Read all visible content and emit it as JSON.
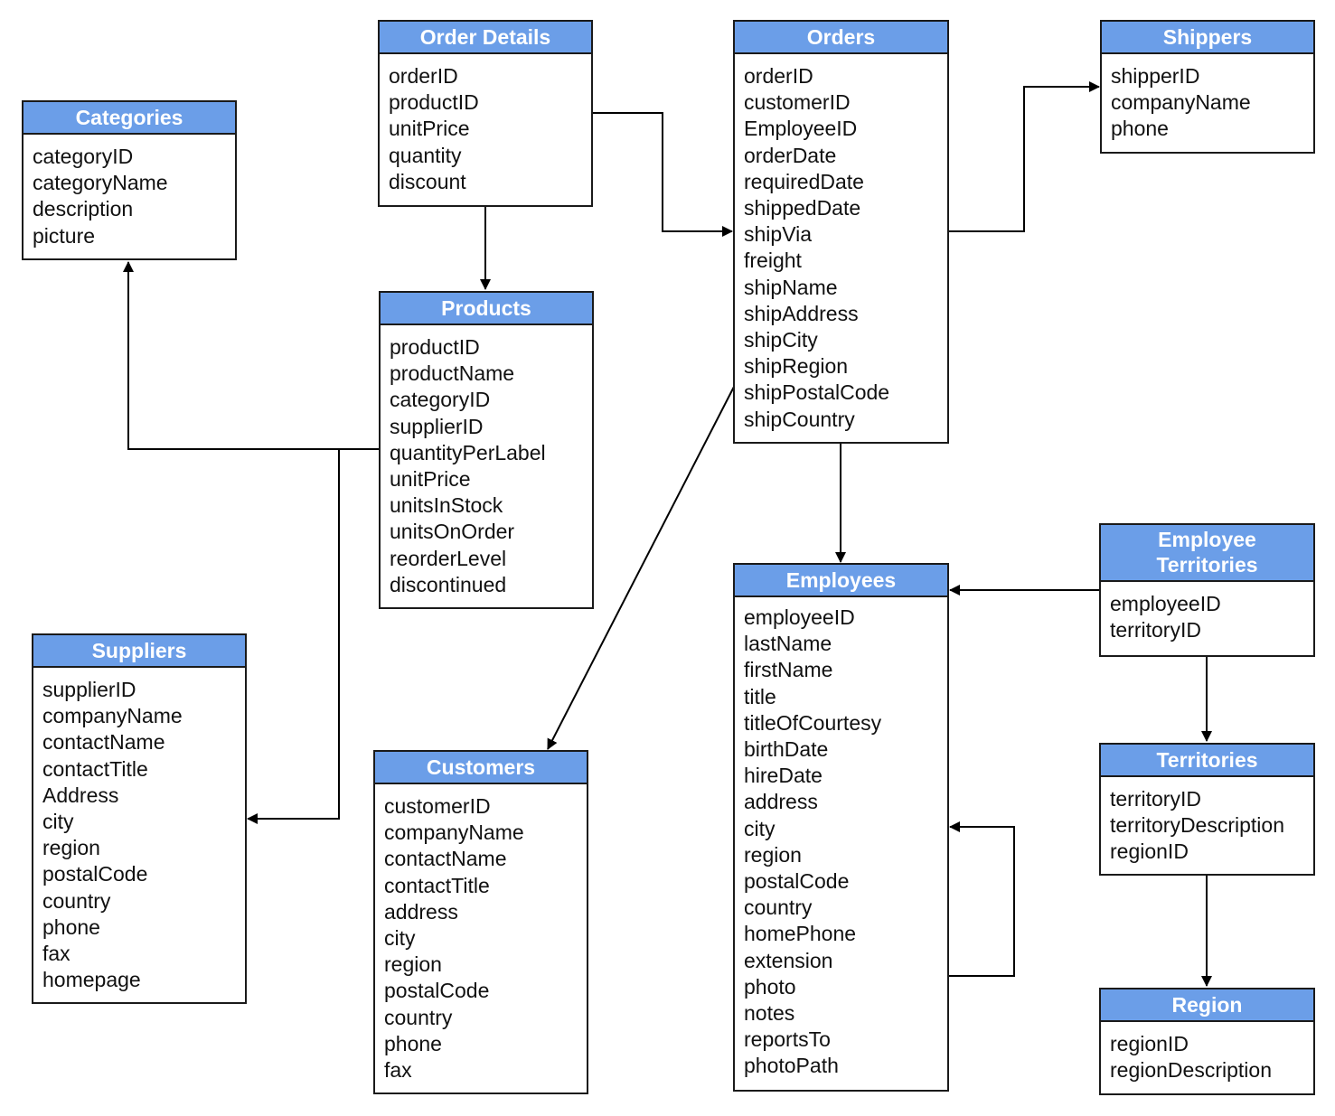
{
  "colors": {
    "header_fill": "#6b9ee8",
    "header_text": "#ffffff",
    "border": "#1a1a1a",
    "line": "#000000"
  },
  "entities": {
    "categories": {
      "title": "Categories",
      "fields": [
        "categoryID",
        "categoryName",
        "description",
        "picture"
      ]
    },
    "order_details": {
      "title": "Order Details",
      "fields": [
        "orderID",
        "productID",
        "unitPrice",
        "quantity",
        "discount"
      ]
    },
    "orders": {
      "title": "Orders",
      "fields": [
        "orderID",
        "customerID",
        "EmployeeID",
        "orderDate",
        "requiredDate",
        "shippedDate",
        "shipVia",
        "freight",
        "shipName",
        "shipAddress",
        "shipCity",
        "shipRegion",
        "shipPostalCode",
        "shipCountry"
      ]
    },
    "shippers": {
      "title": "Shippers",
      "fields": [
        "shipperID",
        "companyName",
        "phone"
      ]
    },
    "products": {
      "title": "Products",
      "fields": [
        "productID",
        "productName",
        "categoryID",
        "supplierID",
        "quantityPerLabel",
        "unitPrice",
        "unitsInStock",
        "unitsOnOrder",
        "reorderLevel",
        "discontinued"
      ]
    },
    "suppliers": {
      "title": "Suppliers",
      "fields": [
        "supplierID",
        "companyName",
        "contactName",
        "contactTitle",
        "Address",
        "city",
        "region",
        "postalCode",
        "country",
        "phone",
        "fax",
        "homepage"
      ]
    },
    "customers": {
      "title": "Customers",
      "fields": [
        "customerID",
        "companyName",
        "contactName",
        "contactTitle",
        "address",
        "city",
        "region",
        "postalCode",
        "country",
        "phone",
        "fax"
      ]
    },
    "employees": {
      "title": "Employees",
      "fields": [
        "employeeID",
        "lastName",
        "firstName",
        "title",
        "titleOfCourtesy",
        "birthDate",
        "hireDate",
        "address",
        "city",
        "region",
        "postalCode",
        "country",
        "homePhone",
        "extension",
        "photo",
        "notes",
        "reportsTo",
        "photoPath"
      ]
    },
    "employee_territories": {
      "title_line1": "Employee",
      "title_line2": "Territories",
      "fields": [
        "employeeID",
        "territoryID"
      ]
    },
    "territories": {
      "title": "Territories",
      "fields": [
        "territoryID",
        "territoryDescription",
        "regionID"
      ]
    },
    "region": {
      "title": "Region",
      "fields": [
        "regionID",
        "regionDescription"
      ]
    }
  },
  "relationships": [
    {
      "from": "Order Details",
      "to": "Orders"
    },
    {
      "from": "Order Details",
      "to": "Products"
    },
    {
      "from": "Orders",
      "to": "Shippers"
    },
    {
      "from": "Orders",
      "to": "Employees"
    },
    {
      "from": "Orders",
      "to": "Customers"
    },
    {
      "from": "Products",
      "to": "Categories"
    },
    {
      "from": "Products",
      "to": "Suppliers"
    },
    {
      "from": "Employee Territories",
      "to": "Employees"
    },
    {
      "from": "Employee Territories",
      "to": "Territories"
    },
    {
      "from": "Territories",
      "to": "Region"
    },
    {
      "from": "Employees",
      "to": "Employees"
    }
  ]
}
